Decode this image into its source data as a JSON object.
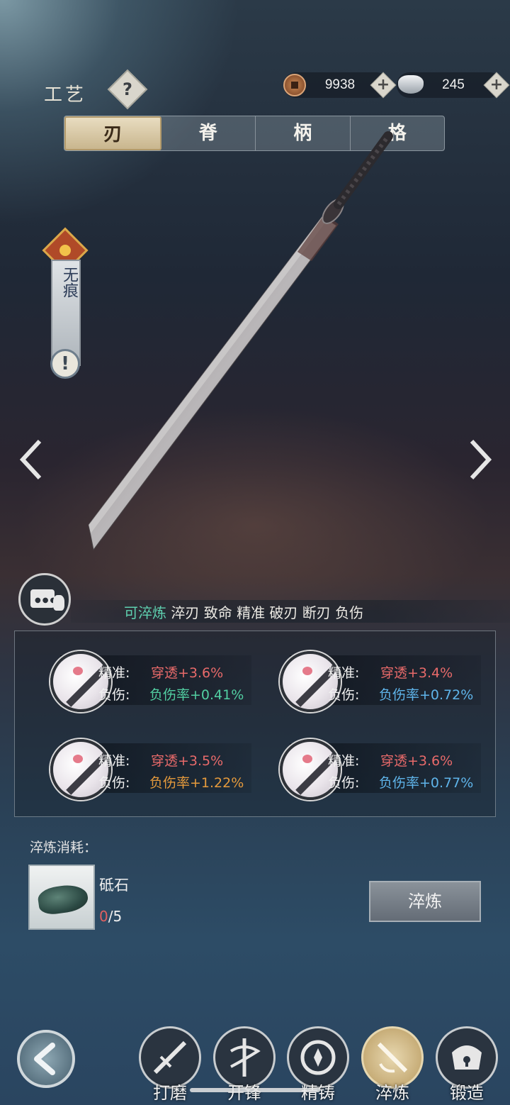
{
  "header": {
    "title": "工艺",
    "help_label": "?",
    "currency": [
      {
        "icon": "copper-coin-icon",
        "value": "9938",
        "plus": "+"
      },
      {
        "icon": "silver-ingot-icon",
        "value": "245",
        "plus": "+"
      }
    ]
  },
  "tabs": [
    {
      "label": "刃",
      "active": true
    },
    {
      "label": "脊",
      "active": false
    },
    {
      "label": "柄",
      "active": false
    },
    {
      "label": "格",
      "active": false
    }
  ],
  "weapon_badge": {
    "name": "无痕",
    "info": "!"
  },
  "attributes": {
    "highlight": "可淬炼",
    "rest": " 淬刃 致命 精准 破刃 断刃 负伤"
  },
  "slots": [
    {
      "k1": "精准:",
      "v1": "穿透+3.6%",
      "k2": "负伤:",
      "v2": "负伤率+0.41%",
      "c1": "#e86a6a",
      "c2": "#52cfa2"
    },
    {
      "k1": "精准:",
      "v1": "穿透+3.4%",
      "k2": "负伤:",
      "v2": "负伤率+0.72%",
      "c1": "#e86a6a",
      "c2": "#5fb4ea"
    },
    {
      "k1": "精准:",
      "v1": "穿透+3.5%",
      "k2": "负伤:",
      "v2": "负伤率+1.22%",
      "c1": "#e86a6a",
      "c2": "#e59a3c"
    },
    {
      "k1": "精准:",
      "v1": "穿透+3.6%",
      "k2": "负伤:",
      "v2": "负伤率+0.77%",
      "c1": "#e86a6a",
      "c2": "#5fb4ea"
    }
  ],
  "cost": {
    "label": "淬炼消耗：",
    "item_name": "砥石",
    "have": "0",
    "need": "/5",
    "button": "淬炼"
  },
  "nav": [
    {
      "label": "打磨",
      "icon": "polish-icon",
      "active": false
    },
    {
      "label": "开锋",
      "icon": "sharpen-icon",
      "active": false
    },
    {
      "label": "精铸",
      "icon": "cast-icon",
      "active": false
    },
    {
      "label": "淬炼",
      "icon": "temper-icon",
      "active": true
    },
    {
      "label": "锻造",
      "icon": "forge-lock-icon",
      "active": false
    }
  ]
}
